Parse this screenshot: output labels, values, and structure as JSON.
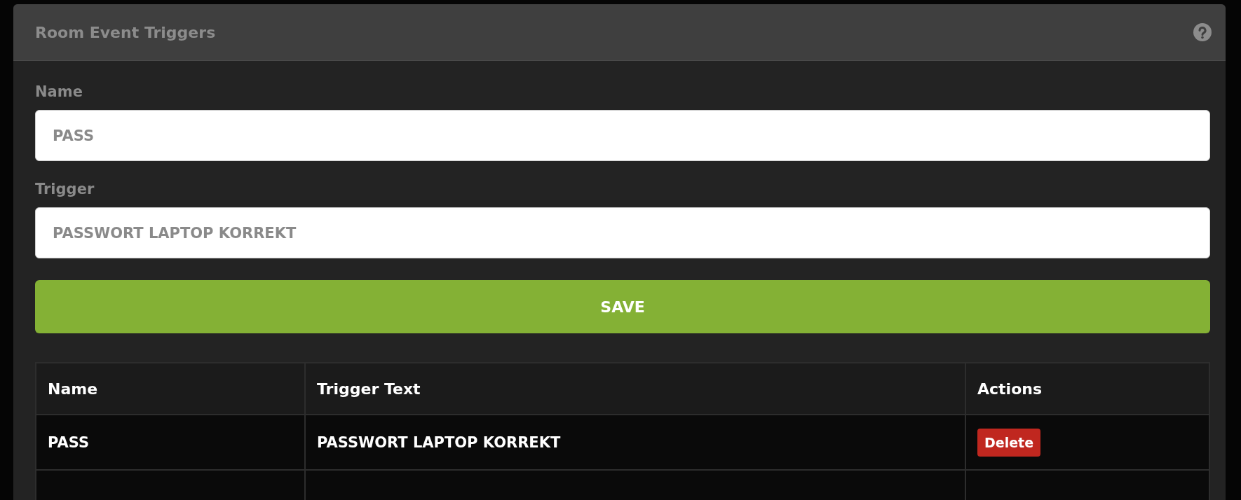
{
  "panel": {
    "title": "Room Event Triggers"
  },
  "form": {
    "fields": [
      {
        "label": "Name",
        "value": "PASS"
      },
      {
        "label": "Trigger",
        "value": "PASSWORT LAPTOP KORREKT"
      }
    ],
    "save_button": "SAVE"
  },
  "table": {
    "columns": [
      "Name",
      "Trigger Text",
      "Actions"
    ],
    "rows": [
      {
        "name": "PASS",
        "trigger_text": "PASSWORT LAPTOP KORREKT",
        "action": "Delete"
      }
    ]
  }
}
